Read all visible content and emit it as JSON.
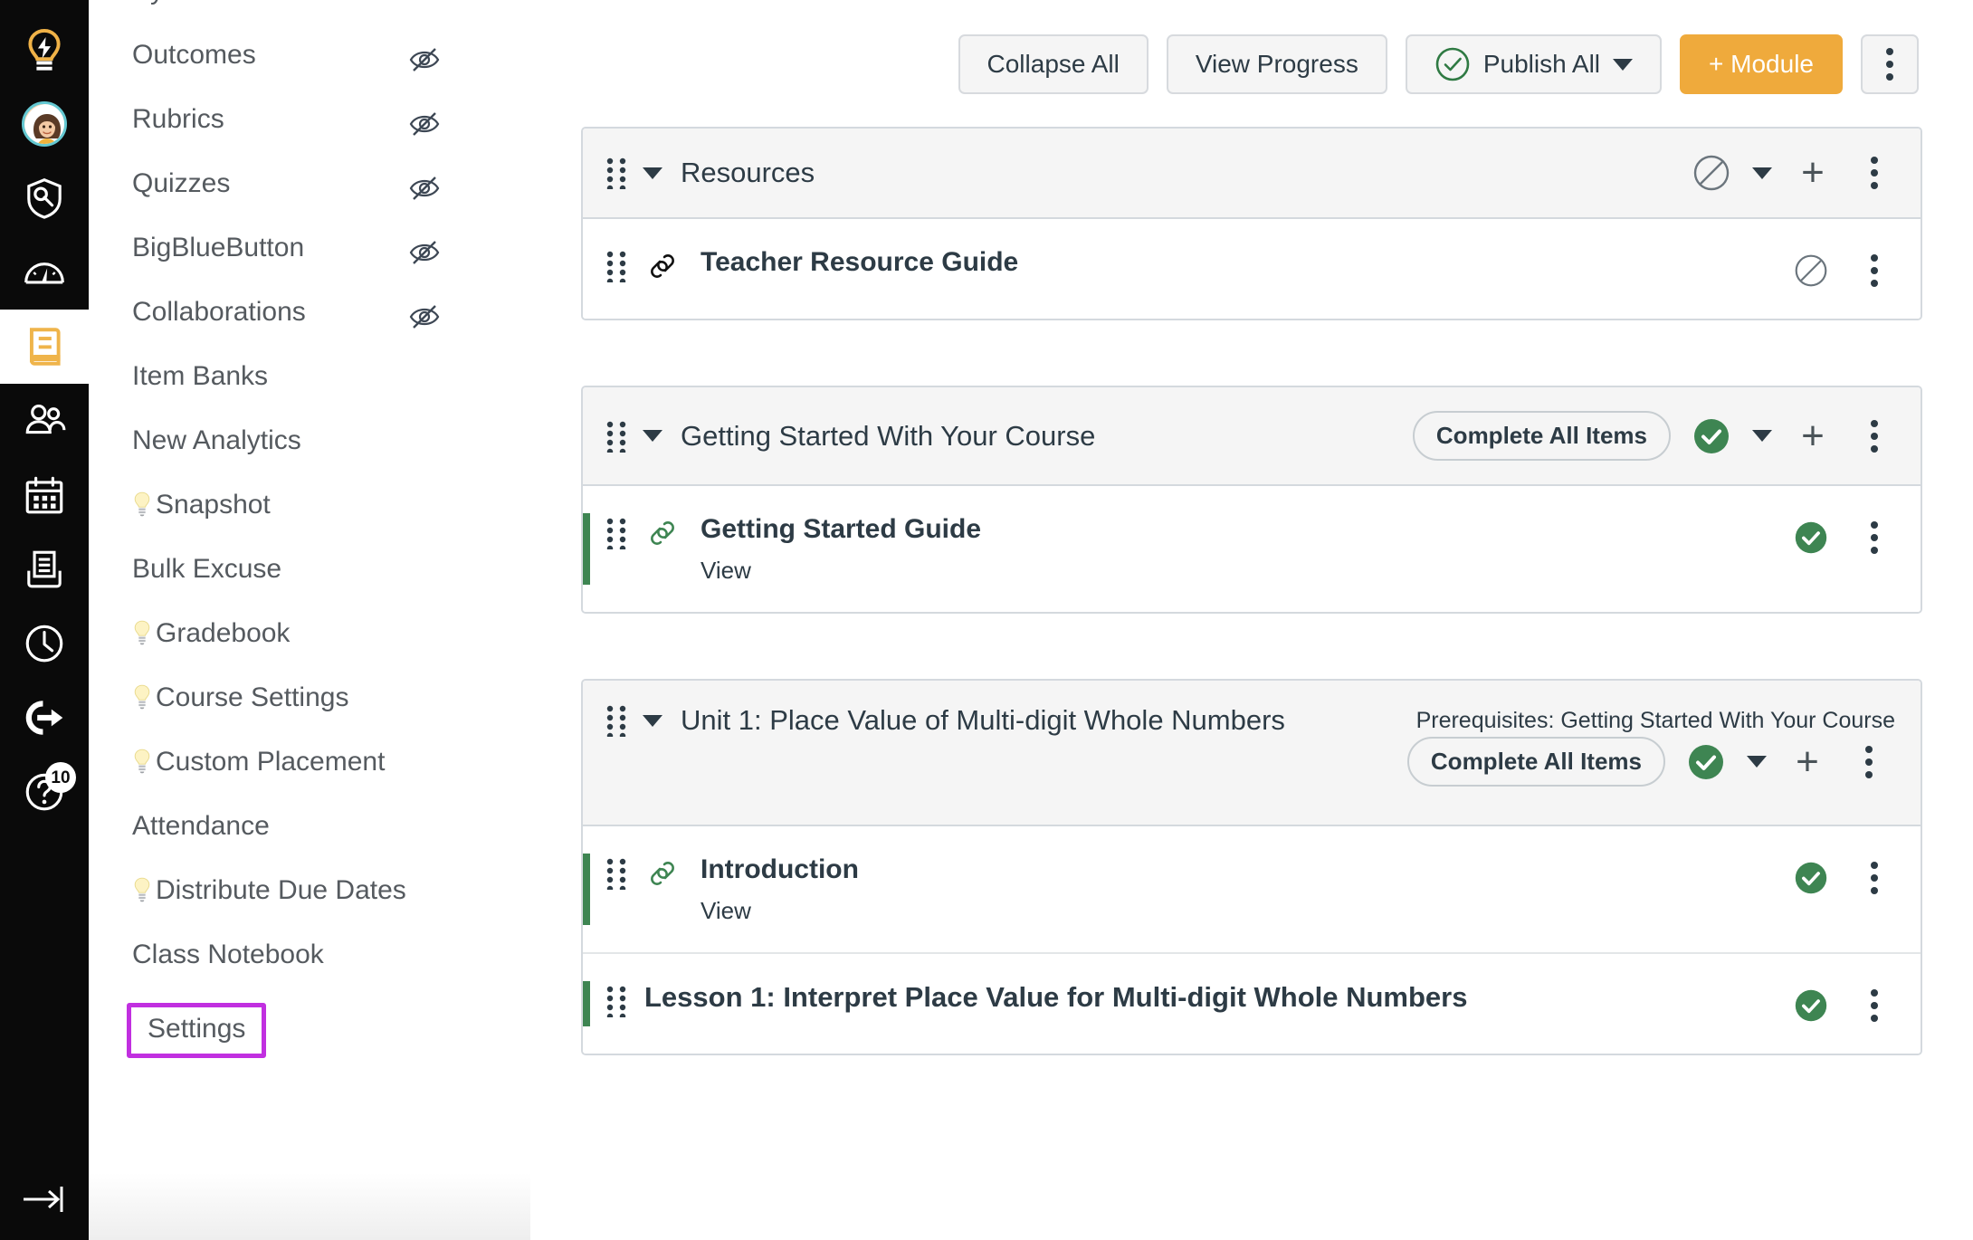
{
  "global_nav": {
    "items": [
      {
        "name": "dashboard-lightbulb",
        "icon": "lightbulb-icon",
        "active": false
      },
      {
        "name": "account",
        "icon": "avatar-icon",
        "active": false
      },
      {
        "name": "admin",
        "icon": "shield-key-icon",
        "active": false
      },
      {
        "name": "dashboard",
        "icon": "speedometer-icon",
        "active": false
      },
      {
        "name": "courses",
        "icon": "book-icon",
        "active": true
      },
      {
        "name": "groups",
        "icon": "people-icon",
        "active": false
      },
      {
        "name": "calendar",
        "icon": "calendar-icon",
        "active": false
      },
      {
        "name": "inbox",
        "icon": "inbox-icon",
        "active": false
      },
      {
        "name": "history",
        "icon": "clock-icon",
        "active": false
      },
      {
        "name": "commons",
        "icon": "arrow-exit-icon",
        "active": false
      },
      {
        "name": "help",
        "icon": "question-icon",
        "active": false
      }
    ],
    "help_badge": "10",
    "collapse_label": "collapse-nav-icon"
  },
  "course_nav": {
    "items": [
      {
        "label": "Syllabus",
        "hidden": false,
        "bulb": false,
        "clipped": true
      },
      {
        "label": "Outcomes",
        "hidden": true,
        "bulb": false
      },
      {
        "label": "Rubrics",
        "hidden": true,
        "bulb": false
      },
      {
        "label": "Quizzes",
        "hidden": true,
        "bulb": false
      },
      {
        "label": "BigBlueButton",
        "hidden": true,
        "bulb": false
      },
      {
        "label": "Collaborations",
        "hidden": true,
        "bulb": false
      },
      {
        "label": "Item Banks",
        "hidden": false,
        "bulb": false
      },
      {
        "label": "New Analytics",
        "hidden": false,
        "bulb": false
      },
      {
        "label": "Snapshot",
        "hidden": false,
        "bulb": true
      },
      {
        "label": "Bulk Excuse",
        "hidden": false,
        "bulb": false
      },
      {
        "label": "Gradebook",
        "hidden": false,
        "bulb": true,
        "extra_space": true
      },
      {
        "label": "Course Settings",
        "hidden": false,
        "bulb": true
      },
      {
        "label": "Custom Placement",
        "hidden": false,
        "bulb": true
      },
      {
        "label": "Attendance",
        "hidden": false,
        "bulb": false
      },
      {
        "label": "Distribute Due Dates",
        "hidden": false,
        "bulb": true
      },
      {
        "label": "Class Notebook",
        "hidden": false,
        "bulb": false
      }
    ],
    "highlighted_item": {
      "label": "Settings",
      "highlight_color": "#c12fe0"
    }
  },
  "toolbar": {
    "collapse_all_label": "Collapse All",
    "view_progress_label": "View Progress",
    "publish_all_label": "Publish All",
    "publish_all_icon": "check-circle-outline-icon",
    "add_module_label": "+ Module",
    "kebab_label": "more-options-icon"
  },
  "modules": [
    {
      "title": "Resources",
      "published": false,
      "publish_icon": "unpublished-circle-slash-icon",
      "has_pill": false,
      "pill_label": "",
      "prerequisites": "",
      "items": [
        {
          "title": "Teacher Resource Guide",
          "subtitle": "",
          "published": false,
          "icon": "link-icon",
          "status_icon": "unpublished-circle-slash-icon"
        }
      ]
    },
    {
      "title": "Getting Started With Your Course",
      "published": true,
      "publish_icon": "published-check-circle-icon",
      "has_pill": true,
      "pill_label": "Complete All Items",
      "prerequisites": "",
      "items": [
        {
          "title": "Getting Started Guide",
          "subtitle": "View",
          "published": true,
          "icon": "link-icon",
          "status_icon": "published-check-circle-icon"
        }
      ]
    },
    {
      "title": "Unit 1: Place Value of Multi-digit Whole Numbers",
      "published": true,
      "publish_icon": "published-check-circle-icon",
      "has_pill": true,
      "pill_label": "Complete All Items",
      "prerequisites": "Prerequisites: Getting Started With Your Course",
      "items": [
        {
          "title": "Introduction",
          "subtitle": "View",
          "published": true,
          "icon": "link-icon",
          "status_icon": "published-check-circle-icon"
        },
        {
          "title": "Lesson 1: Interpret Place Value for Multi-digit Whole Numbers",
          "subtitle": "",
          "published": true,
          "icon": "none",
          "status_icon": "published-check-circle-icon",
          "plain": true
        }
      ]
    }
  ],
  "colors": {
    "brand_orange": "#efaa3c",
    "published_green": "#3e8552",
    "highlight_purple": "#c12fe0",
    "avatar_ring": "#64c8d2",
    "text_dark": "#2d3b45",
    "nav_text": "#555a5f"
  }
}
